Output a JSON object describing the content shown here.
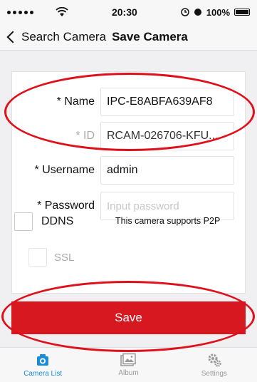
{
  "status_bar": {
    "time": "20:30",
    "battery": "100%"
  },
  "nav": {
    "back_label": "Search Camera",
    "title": "Save Camera"
  },
  "form": {
    "name": {
      "label": "* Name",
      "value": "IPC-E8ABFA639AF8"
    },
    "id": {
      "label": "* ID",
      "value": "RCAM-026706-KFU..."
    },
    "username": {
      "label": "* Username",
      "value": "admin"
    },
    "password": {
      "label": "* Password",
      "placeholder": "Input password"
    },
    "ddns": {
      "label": "DDNS",
      "checked": false
    },
    "p2p_note": "This camera supports P2P",
    "ssl": {
      "label": "SSL",
      "checked": false
    }
  },
  "save_label": "Save",
  "tabs": [
    {
      "label": "Camera List",
      "icon": "camera-icon",
      "active": true
    },
    {
      "label": "Album",
      "icon": "album-icon",
      "active": false
    },
    {
      "label": "Settings",
      "icon": "gear-icon",
      "active": false
    }
  ],
  "colors": {
    "accent": "#d71820",
    "tab_active": "#1a8cd8"
  }
}
